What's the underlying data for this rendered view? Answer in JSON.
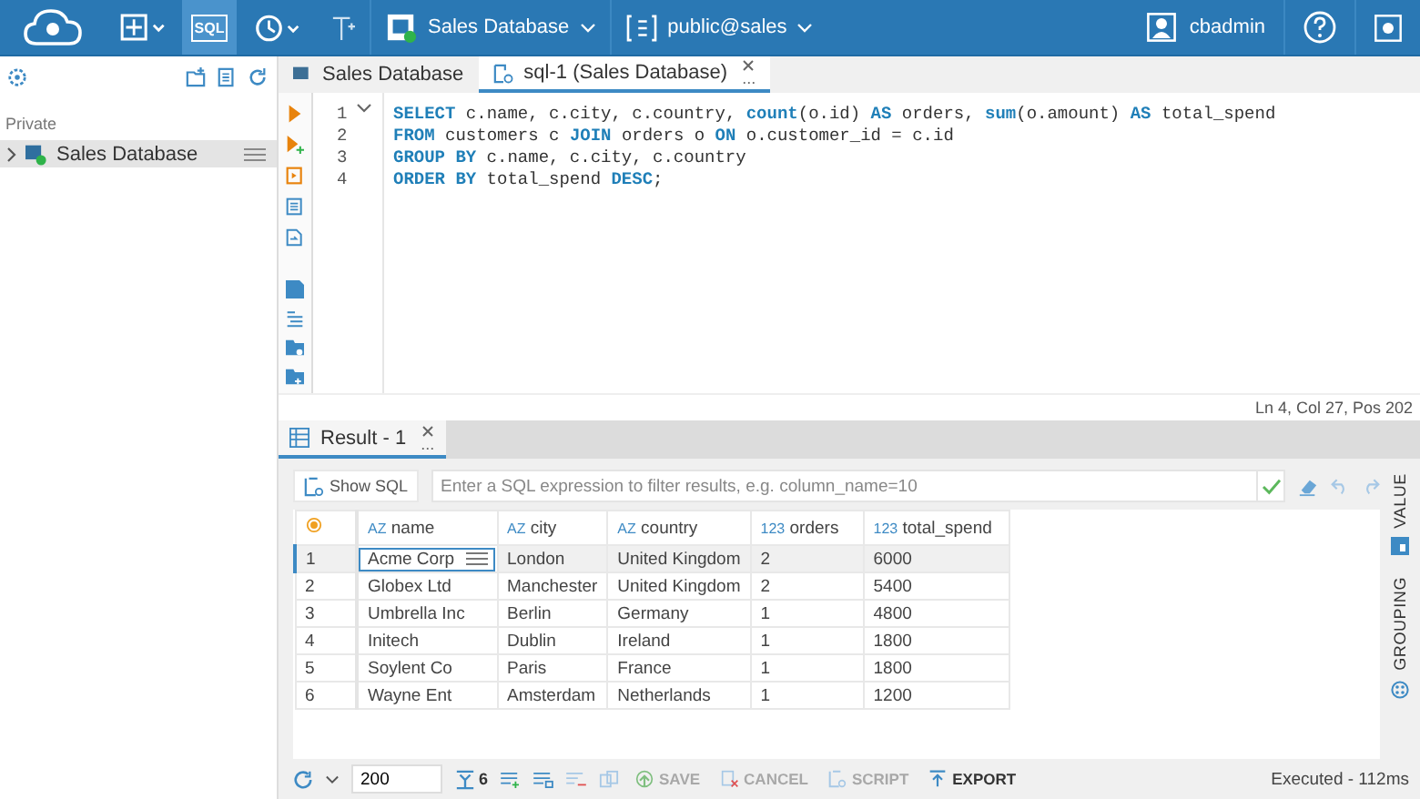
{
  "topbar": {
    "sql_button": {
      "label": "SQL",
      "selected": true
    },
    "connection": "Sales Database",
    "schema": "public@sales",
    "user": "cbadmin"
  },
  "navigator": {
    "section": "Private",
    "items": [
      {
        "label": "Sales Database",
        "selected": true,
        "connected": true
      }
    ]
  },
  "editor_tabs": [
    {
      "label": "Sales Database",
      "selected": false,
      "closable": false
    },
    {
      "label": "sql-1 (Sales Database)",
      "selected": true,
      "closable": true,
      "menu": "..."
    }
  ],
  "code_lines": [
    {
      "number": "1",
      "foldable": true,
      "text": "**SELECT** c.name, c.city, c.country, **count**(o.id) **AS** orders, **sum**(o.amount) **AS** total_spend"
    },
    {
      "number": "2",
      "foldable": false,
      "text": "**FROM** customers c **JOIN** orders o **ON** o.customer_id = c.id"
    },
    {
      "number": "3",
      "foldable": false,
      "text": "**GROUP BY** c.name, c.city, c.country"
    },
    {
      "number": "4",
      "foldable": false,
      "text": "**ORDER BY** total_spend **DESC**;"
    }
  ],
  "cursor_status": "Ln 4, Col 27, Pos 202",
  "result_tabs": [
    {
      "label": "Result - 1",
      "selected": true,
      "menu": "..."
    }
  ],
  "filter": {
    "show_sql": "Show SQL",
    "placeholder": "Enter a SQL expression to filter results, e.g. column_name=10"
  },
  "table": {
    "columns": [
      {
        "type_label": "AZ",
        "name": "name"
      },
      {
        "type_label": "AZ",
        "name": "city"
      },
      {
        "type_label": "AZ",
        "name": "country"
      },
      {
        "type_label": "123",
        "name": "orders"
      },
      {
        "type_label": "123",
        "name": "total_spend"
      }
    ],
    "rows": [
      {
        "number": "1",
        "selected": true,
        "cells": [
          "Acme Corp",
          "London",
          "United Kingdom",
          "2",
          "6000"
        ]
      },
      {
        "number": "2",
        "selected": false,
        "cells": [
          "Globex Ltd",
          "Manchester",
          "United Kingdom",
          "2",
          "5400"
        ]
      },
      {
        "number": "3",
        "selected": false,
        "cells": [
          "Umbrella Inc",
          "Berlin",
          "Germany",
          "1",
          "4800"
        ]
      },
      {
        "number": "4",
        "selected": false,
        "cells": [
          "Initech",
          "Dublin",
          "Ireland",
          "1",
          "1800"
        ]
      },
      {
        "number": "5",
        "selected": false,
        "cells": [
          "Soylent Co",
          "Paris",
          "France",
          "1",
          "1800"
        ]
      },
      {
        "number": "6",
        "selected": false,
        "cells": [
          "Wayne Ent",
          "Amsterdam",
          "Netherlands",
          "1",
          "1200"
        ]
      }
    ]
  },
  "side_panels": [
    "VALUE",
    "GROUPING"
  ],
  "bottom_bar": {
    "fetch_size": "200",
    "row_count": "6",
    "actions": [
      {
        "label": "SAVE",
        "disabled": true
      },
      {
        "label": "CANCEL",
        "disabled": true
      },
      {
        "label": "SCRIPT",
        "disabled": true
      },
      {
        "label": "EXPORT",
        "disabled": false
      }
    ],
    "status": "Executed - 112ms"
  }
}
